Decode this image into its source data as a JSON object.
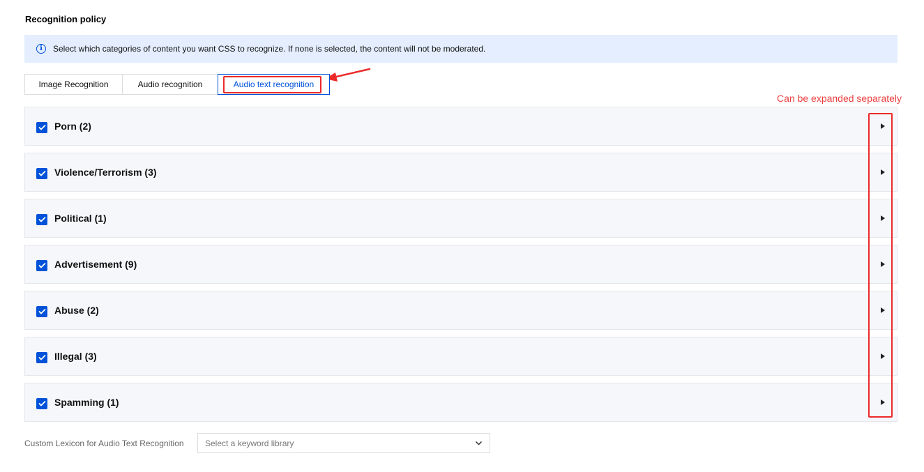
{
  "section_title": "Recognition policy",
  "info_banner": {
    "text": "Select which categories of content you want CSS to recognize. If none is selected, the content will not be moderated."
  },
  "tabs": [
    {
      "label": "Image Recognition",
      "active": false
    },
    {
      "label": "Audio recognition",
      "active": false
    },
    {
      "label": "Audio text recognition",
      "active": true
    }
  ],
  "annotation": {
    "callout_text": "Can be expanded separately",
    "color": "#ec2a2a"
  },
  "categories": [
    {
      "label": "Porn (2)",
      "checked": true
    },
    {
      "label": "Violence/Terrorism (3)",
      "checked": true
    },
    {
      "label": "Political (1)",
      "checked": true
    },
    {
      "label": "Advertisement (9)",
      "checked": true
    },
    {
      "label": "Abuse (2)",
      "checked": true
    },
    {
      "label": "Illegal (3)",
      "checked": true
    },
    {
      "label": "Spamming (1)",
      "checked": true
    }
  ],
  "lexicon": {
    "label": "Custom Lexicon for Audio Text Recognition",
    "placeholder": "Select a keyword library"
  },
  "colors": {
    "accent": "#0052d9",
    "banner_bg": "#e5eefe",
    "row_bg": "#f6f7fb",
    "annotation": "#ec2a2a"
  }
}
